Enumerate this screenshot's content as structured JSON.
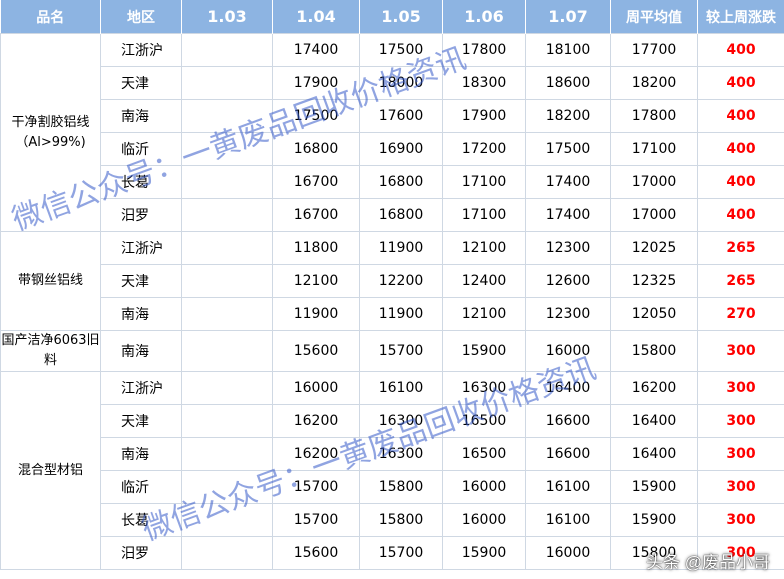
{
  "headers": [
    "品名",
    "地区",
    "1.03",
    "1.04",
    "1.05",
    "1.06",
    "1.07",
    "周平均值",
    "较上周涨跌"
  ],
  "groups": [
    {
      "name": "干净割胶铝线（Al>99%)",
      "rows": [
        {
          "region": "江浙沪",
          "d103": "",
          "d104": "17400",
          "d105": "17500",
          "d106": "17800",
          "d107": "18100",
          "avg": "17700",
          "chg": "400"
        },
        {
          "region": "天津",
          "d103": "",
          "d104": "17900",
          "d105": "18000",
          "d106": "18300",
          "d107": "18600",
          "avg": "18200",
          "chg": "400"
        },
        {
          "region": "南海",
          "d103": "",
          "d104": "17500",
          "d105": "17600",
          "d106": "17900",
          "d107": "18200",
          "avg": "17800",
          "chg": "400"
        },
        {
          "region": "临沂",
          "d103": "",
          "d104": "16800",
          "d105": "16900",
          "d106": "17200",
          "d107": "17500",
          "avg": "17100",
          "chg": "400"
        },
        {
          "region": "长葛",
          "d103": "",
          "d104": "16700",
          "d105": "16800",
          "d106": "17100",
          "d107": "17400",
          "avg": "17000",
          "chg": "400"
        },
        {
          "region": "汨罗",
          "d103": "",
          "d104": "16700",
          "d105": "16800",
          "d106": "17100",
          "d107": "17400",
          "avg": "17000",
          "chg": "400"
        }
      ]
    },
    {
      "name": "带钢丝铝线",
      "rows": [
        {
          "region": "江浙沪",
          "d103": "",
          "d104": "11800",
          "d105": "11900",
          "d106": "12100",
          "d107": "12300",
          "avg": "12025",
          "chg": "265"
        },
        {
          "region": "天津",
          "d103": "",
          "d104": "12100",
          "d105": "12200",
          "d106": "12400",
          "d107": "12600",
          "avg": "12325",
          "chg": "265"
        },
        {
          "region": "南海",
          "d103": "",
          "d104": "11900",
          "d105": "11900",
          "d106": "12100",
          "d107": "12300",
          "avg": "12050",
          "chg": "270"
        }
      ]
    },
    {
      "name": "国产洁净6063旧料",
      "rows": [
        {
          "region": "南海",
          "d103": "",
          "d104": "15600",
          "d105": "15700",
          "d106": "15900",
          "d107": "16000",
          "avg": "15800",
          "chg": "300"
        }
      ]
    },
    {
      "name": "混合型材铝",
      "rows": [
        {
          "region": "江浙沪",
          "d103": "",
          "d104": "16000",
          "d105": "16100",
          "d106": "16300",
          "d107": "16400",
          "avg": "16200",
          "chg": "300"
        },
        {
          "region": "天津",
          "d103": "",
          "d104": "16200",
          "d105": "16300",
          "d106": "16500",
          "d107": "16600",
          "avg": "16400",
          "chg": "300"
        },
        {
          "region": "南海",
          "d103": "",
          "d104": "16200",
          "d105": "16300",
          "d106": "16500",
          "d107": "16600",
          "avg": "16400",
          "chg": "300"
        },
        {
          "region": "临沂",
          "d103": "",
          "d104": "15700",
          "d105": "15800",
          "d106": "16000",
          "d107": "16100",
          "avg": "15900",
          "chg": "300"
        },
        {
          "region": "长葛",
          "d103": "",
          "d104": "15700",
          "d105": "15800",
          "d106": "16000",
          "d107": "16100",
          "avg": "15900",
          "chg": "300"
        },
        {
          "region": "汨罗",
          "d103": "",
          "d104": "15600",
          "d105": "15700",
          "d106": "15900",
          "d107": "16000",
          "avg": "15800",
          "chg": "300"
        }
      ]
    }
  ],
  "watermarks": [
    "微信公众号：一黄废品回收价格资讯",
    "微信公众号：一黄废品回收价格资讯"
  ],
  "credit": "头条 @废品小哥",
  "colors": {
    "header_bg": "#8db4e2",
    "change_text": "#ff0000",
    "watermark": "#345ac8"
  }
}
